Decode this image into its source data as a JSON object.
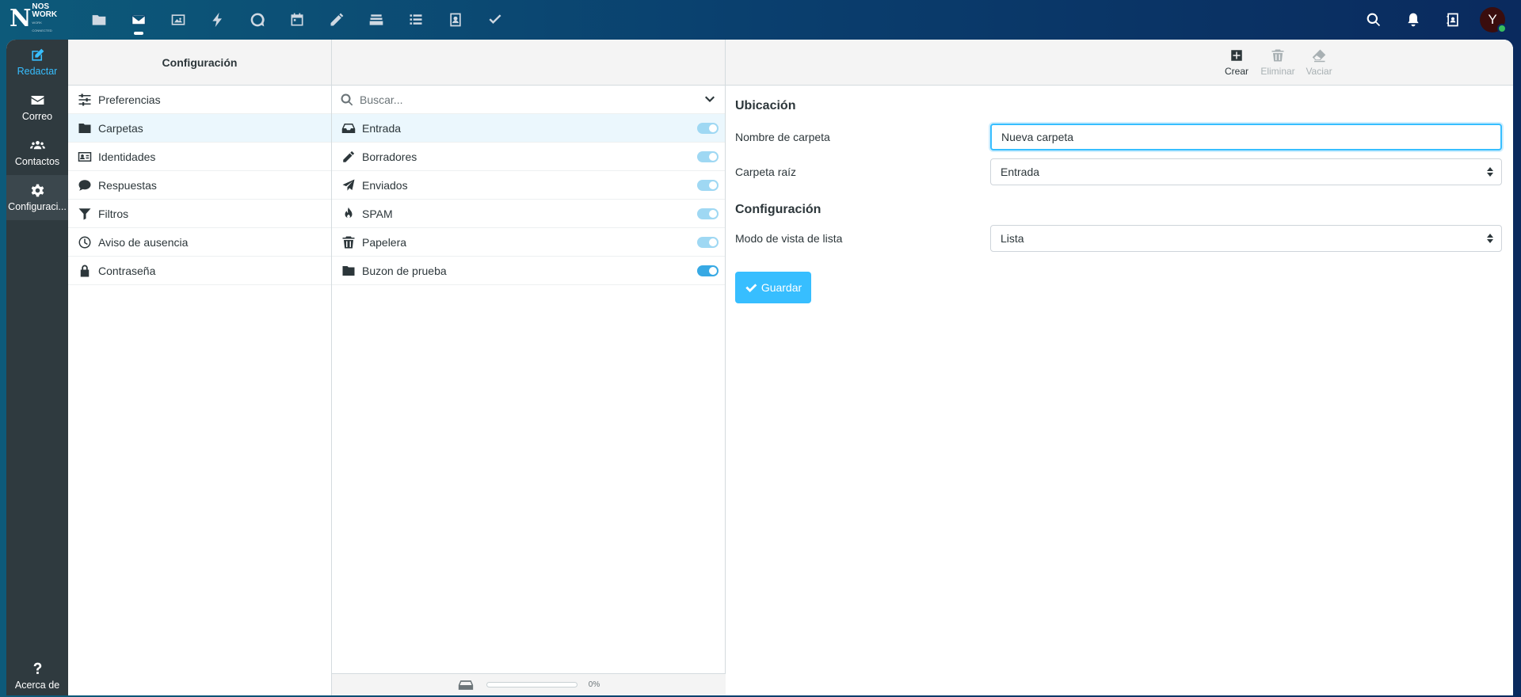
{
  "brand": {
    "name_line1": "NOS",
    "name_line2": "WORK",
    "tagline": "WORK CONNECTED"
  },
  "user": {
    "initial": "Y"
  },
  "leftnav": {
    "compose": "Redactar",
    "mail": "Correo",
    "contacts": "Contactos",
    "settings": "Configuraci...",
    "about": "Acerca de"
  },
  "settings_panel": {
    "title": "Configuración",
    "items": [
      {
        "label": "Preferencias",
        "icon": "sliders-icon"
      },
      {
        "label": "Carpetas",
        "icon": "folder-icon"
      },
      {
        "label": "Identidades",
        "icon": "id-card-icon"
      },
      {
        "label": "Respuestas",
        "icon": "comment-icon"
      },
      {
        "label": "Filtros",
        "icon": "filter-icon"
      },
      {
        "label": "Aviso de ausencia",
        "icon": "clock-icon"
      },
      {
        "label": "Contraseña",
        "icon": "lock-icon"
      }
    ]
  },
  "folders_panel": {
    "search_placeholder": "Buscar...",
    "folders": [
      {
        "label": "Entrada",
        "icon": "inbox-icon"
      },
      {
        "label": "Borradores",
        "icon": "pencil-icon"
      },
      {
        "label": "Enviados",
        "icon": "paper-plane-icon"
      },
      {
        "label": "SPAM",
        "icon": "fire-icon"
      },
      {
        "label": "Papelera",
        "icon": "trash-icon"
      },
      {
        "label": "Buzon de prueba",
        "icon": "folder-icon"
      }
    ],
    "quota_text": "0%",
    "quota_fraction": 0
  },
  "toolbar": {
    "create": "Crear",
    "delete": "Eliminar",
    "empty": "Vaciar"
  },
  "form": {
    "section_location": "Ubicación",
    "folder_name_label": "Nombre de carpeta",
    "folder_name_value": "Nueva carpeta",
    "parent_label": "Carpeta raíz",
    "parent_value": "Entrada",
    "section_config": "Configuración",
    "view_mode_label": "Modo de vista de lista",
    "view_mode_value": "Lista",
    "save": "Guardar"
  },
  "colors": {
    "accent": "#37beff",
    "nav_bg": "#2f3a3f",
    "selected_row": "#ebf7fd"
  }
}
